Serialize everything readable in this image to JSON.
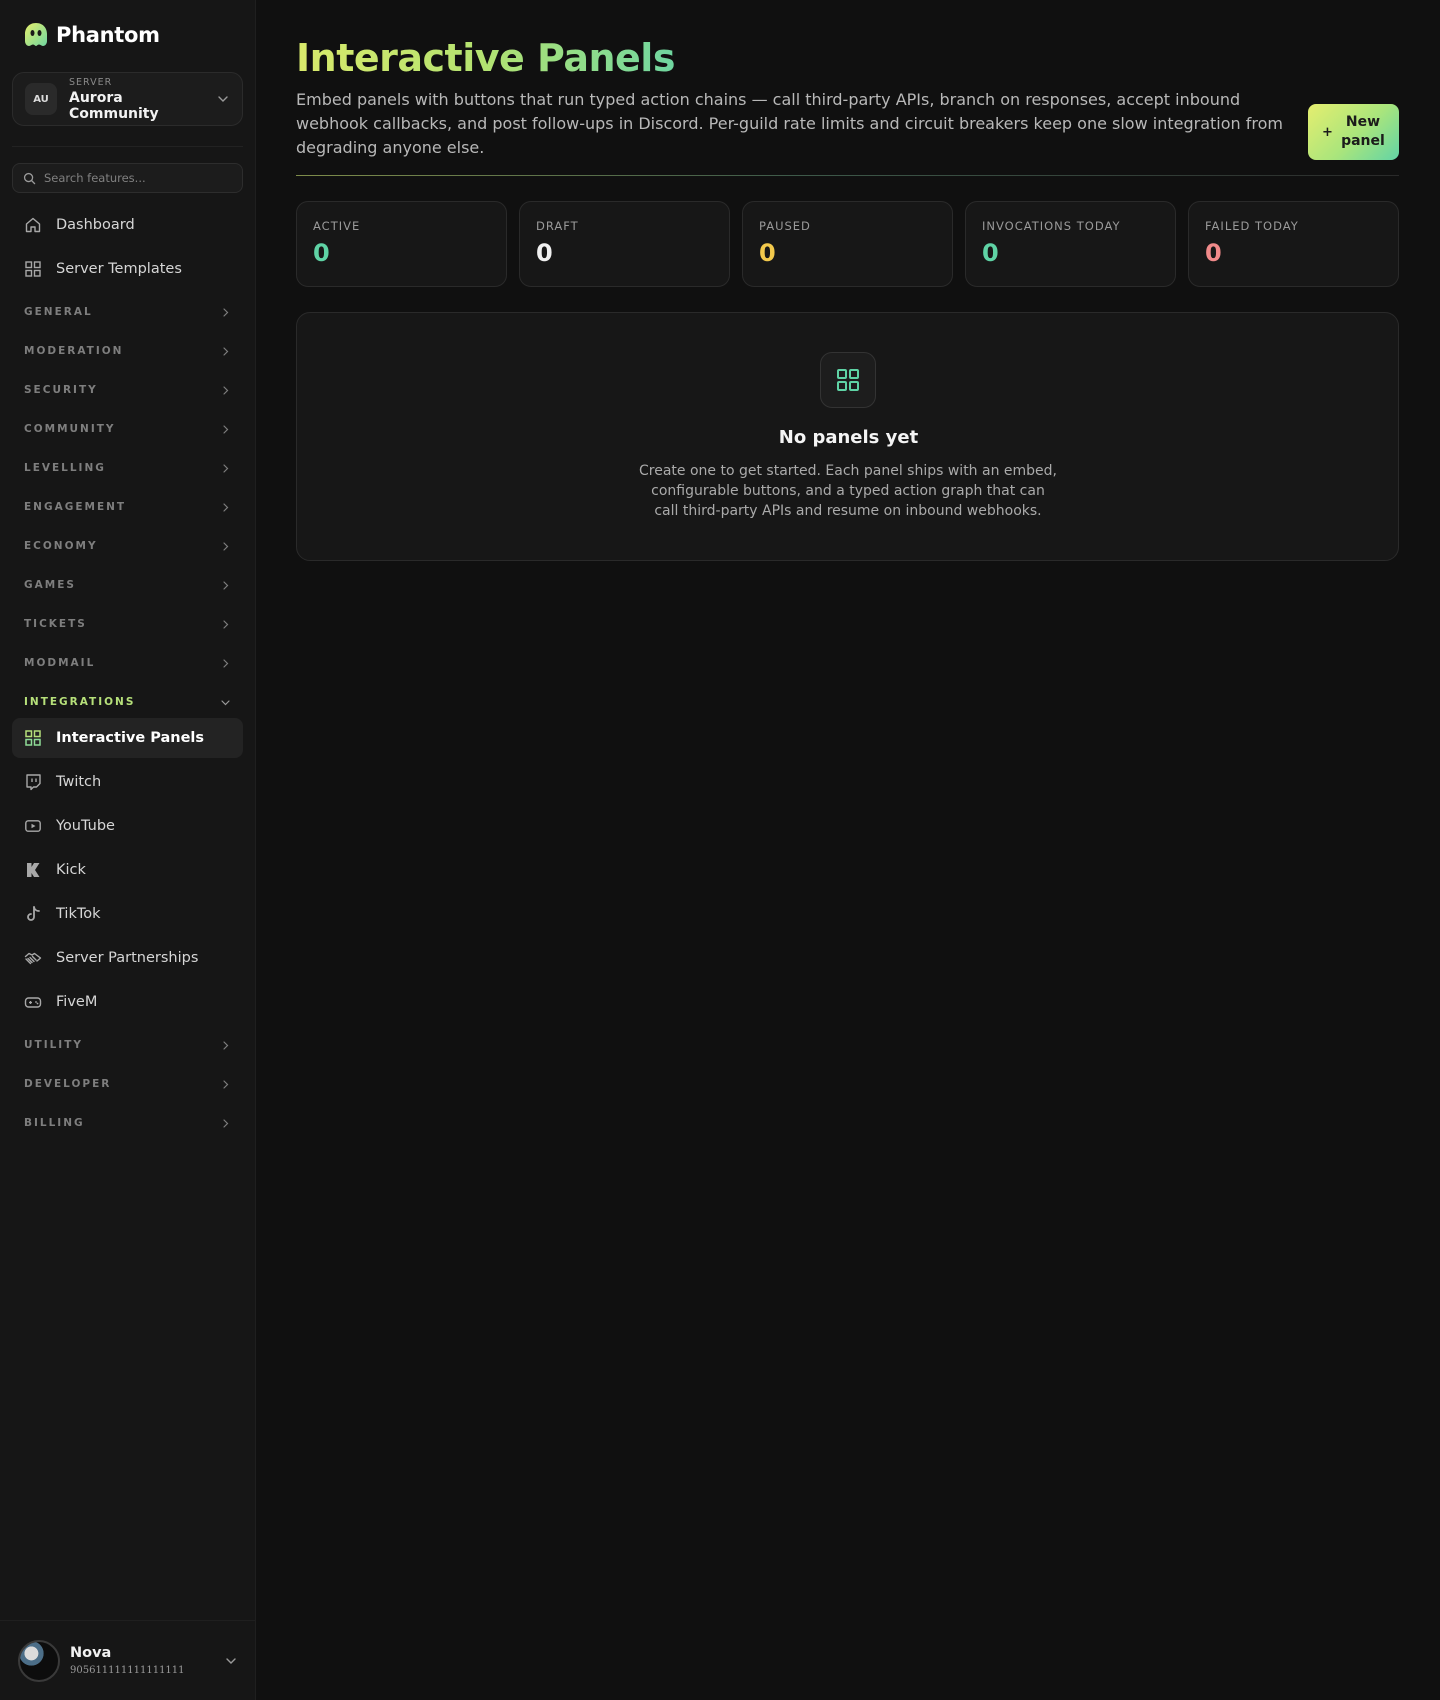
{
  "app": {
    "name": "Phantom"
  },
  "server": {
    "kicker": "SERVER",
    "initials": "AU",
    "name": "Aurora Community"
  },
  "search": {
    "placeholder": "Search features..."
  },
  "nav_top": [
    {
      "label": "Dashboard",
      "icon": "home-icon"
    },
    {
      "label": "Server Templates",
      "icon": "grid-icon"
    }
  ],
  "sections": {
    "general": "GENERAL",
    "moderation": "MODERATION",
    "security": "SECURITY",
    "community": "COMMUNITY",
    "levelling": "LEVELLING",
    "engagement": "ENGAGEMENT",
    "economy": "ECONOMY",
    "games": "GAMES",
    "tickets": "TICKETS",
    "modmail": "MODMAIL",
    "integrations": "INTEGRATIONS",
    "utility": "UTILITY",
    "developer": "DEVELOPER",
    "billing": "BILLING"
  },
  "integrations_items": [
    {
      "label": "Interactive Panels",
      "icon": "grid-icon",
      "active": true
    },
    {
      "label": "Twitch",
      "icon": "twitch-icon"
    },
    {
      "label": "YouTube",
      "icon": "youtube-icon"
    },
    {
      "label": "Kick",
      "icon": "kick-icon"
    },
    {
      "label": "TikTok",
      "icon": "tiktok-icon"
    },
    {
      "label": "Server Partnerships",
      "icon": "handshake-icon"
    },
    {
      "label": "FiveM",
      "icon": "gamepad-icon"
    }
  ],
  "user": {
    "name": "Nova",
    "id": "905611111111111111"
  },
  "page": {
    "title": "Interactive Panels",
    "description": "Embed panels with buttons that run typed action chains — call third-party APIs, branch on responses, accept inbound webhook callbacks, and post follow-ups in Discord. Per-guild rate limits and circuit breakers keep one slow integration from degrading anyone else.",
    "new_button": {
      "plus": "+",
      "label": "New panel"
    }
  },
  "stats": [
    {
      "label": "ACTIVE",
      "value": "0",
      "color": "#5fd3a5"
    },
    {
      "label": "DRAFT",
      "value": "0",
      "color": "#f0f0f0"
    },
    {
      "label": "PAUSED",
      "value": "0",
      "color": "#f2c94c"
    },
    {
      "label": "INVOCATIONS TODAY",
      "value": "0",
      "color": "#5fd3a5"
    },
    {
      "label": "FAILED TODAY",
      "value": "0",
      "color": "#f08a8a"
    }
  ],
  "empty": {
    "icon": "grid-icon",
    "title": "No panels yet",
    "description": "Create one to get started. Each panel ships with an embed, configurable buttons, and a typed action graph that can call third-party APIs and resume on inbound webhooks."
  },
  "colors": {
    "accent_lime": "#d9ea6b",
    "accent_teal": "#5fd3a5",
    "background": "#101010",
    "sidebar": "#161616"
  }
}
